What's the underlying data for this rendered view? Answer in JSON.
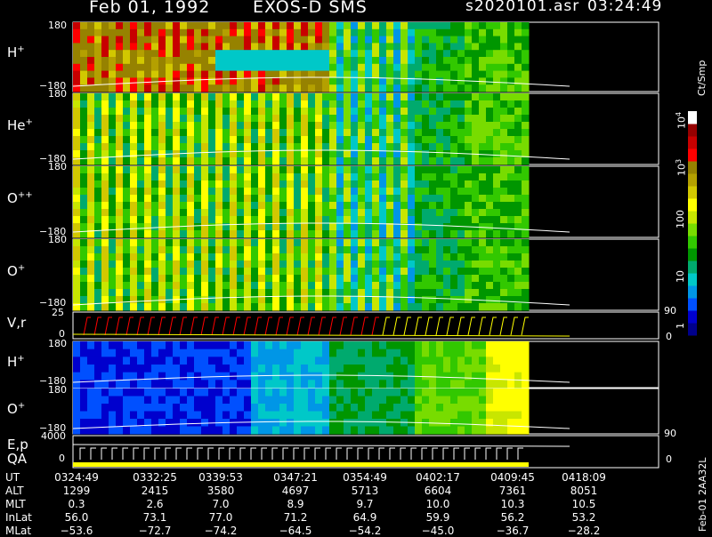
{
  "chart_data": {
    "type": "heatmap",
    "header": {
      "date": "Feb 01, 1992",
      "instrument": "EXOS-D SMS",
      "file": "s2020101.asr",
      "time": "03:24:49"
    },
    "panels": [
      {
        "name": "pitch-H",
        "label": "H",
        "sup": "+",
        "ytop": "180",
        "ybot": "−180"
      },
      {
        "name": "pitch-He",
        "label": "He",
        "sup": "+",
        "ytop": "180",
        "ybot": "−180"
      },
      {
        "name": "pitch-Opp",
        "label": "O",
        "sup": "++",
        "ytop": "180",
        "ybot": "−180"
      },
      {
        "name": "pitch-O",
        "label": "O",
        "sup": "+",
        "ytop": "180",
        "ybot": "−180"
      },
      {
        "name": "vr",
        "label": "V,r",
        "sup": "",
        "ytop": "25",
        "ybot": "0",
        "rtop": "90",
        "rbot": "0"
      },
      {
        "name": "spec-H",
        "label": "H",
        "sup": "+",
        "ytop": "180",
        "ybot": "−180"
      },
      {
        "name": "spec-O",
        "label": "O",
        "sup": "+",
        "ytop": "180",
        "ybot": "−180"
      },
      {
        "name": "ep",
        "label": "E,p",
        "label2": "QA",
        "sup": "",
        "ytop": "4000",
        "ybot": "0",
        "rtop": "90",
        "rbot": "0"
      }
    ],
    "colorbar": {
      "unit": "Ct/Smp",
      "ticks": [
        {
          "value": "1"
        },
        {
          "value": "10"
        },
        {
          "value": "100"
        },
        {
          "value": "10",
          "sup": "3"
        },
        {
          "value": "10",
          "sup": "4"
        }
      ],
      "colors": [
        "#00008b",
        "#0000cd",
        "#0050ff",
        "#0096e6",
        "#00c8c8",
        "#00aa6e",
        "#009600",
        "#32c800",
        "#78dc00",
        "#c8e600",
        "#ffff00",
        "#d2c800",
        "#b4a000",
        "#968200",
        "#ff0000",
        "#c80000",
        "#960000",
        "#ffffff"
      ]
    },
    "time_axis": {
      "labels": [
        "UT",
        "ALT",
        "MLT",
        "InLat",
        "MLat"
      ],
      "ut": [
        "0324:49",
        "0332:25",
        "0339:53",
        "0347:21",
        "0354:49",
        "0402:17",
        "0409:45",
        "0418:09"
      ],
      "alt": [
        "1299",
        "2415",
        "3580",
        "4697",
        "5713",
        "6604",
        "7361",
        "8051"
      ],
      "mlt": [
        "0.3",
        "2.6",
        "7.0",
        "8.9",
        "9.7",
        "10.0",
        "10.3",
        "10.5"
      ],
      "inlat": [
        "56.0",
        "73.1",
        "77.0",
        "71.2",
        "64.9",
        "59.9",
        "56.2",
        "53.2"
      ],
      "mlat": [
        "−53.6",
        "−72.7",
        "−74.2",
        "−64.5",
        "−54.2",
        "−45.0",
        "−36.7",
        "−28.2"
      ]
    },
    "footer": {
      "id": "Feb-01 2AA32L"
    }
  }
}
